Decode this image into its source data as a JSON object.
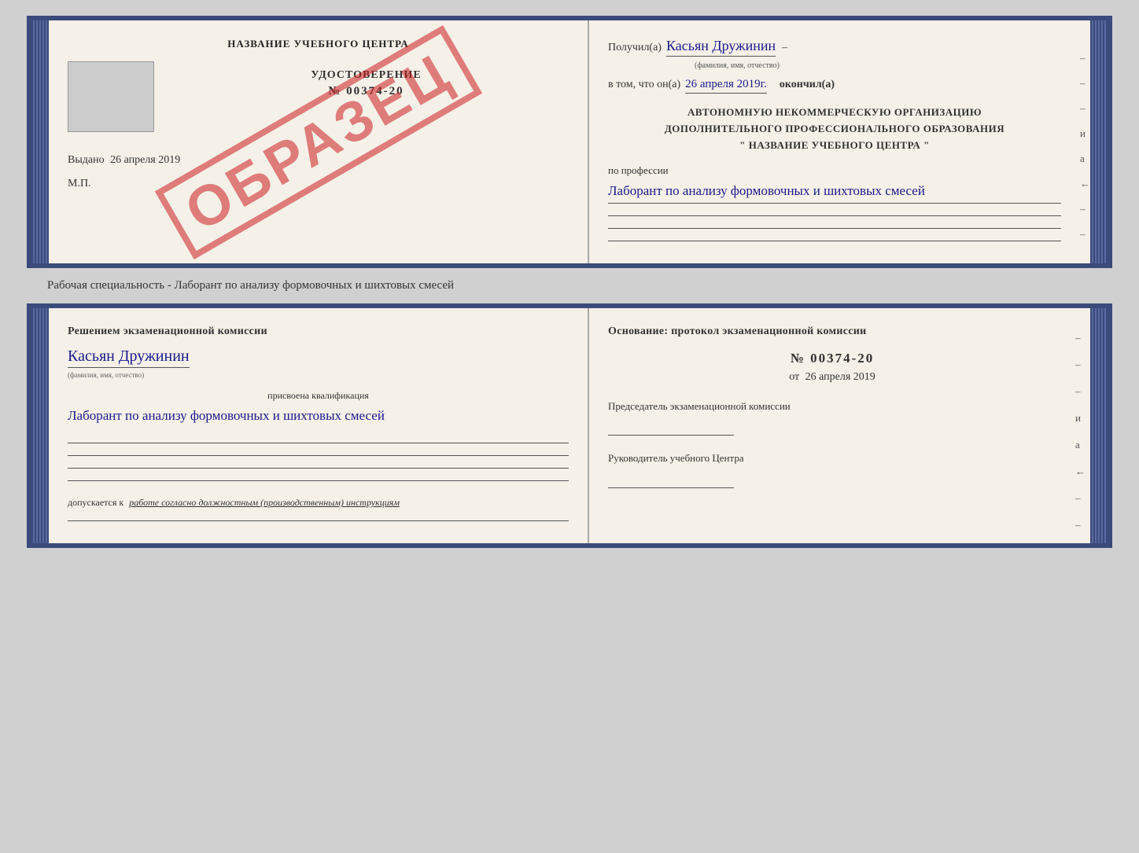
{
  "top_card": {
    "left": {
      "title": "НАЗВАНИЕ УЧЕБНОГО ЦЕНТРА",
      "cert_label": "УДОСТОВЕРЕНИЕ",
      "cert_number": "№ 00374-20",
      "issued_text": "Выдано",
      "issued_date": "26 апреля 2019",
      "mp_label": "М.П.",
      "stamp_text": "ОБРАЗЕЦ"
    },
    "right": {
      "received_label": "Получил(а)",
      "received_name": "Касьян Дружинин",
      "name_sub": "(фамилия, имя, отчество)",
      "in_that_label": "в том, что он(а)",
      "date_value": "26 апреля 2019г.",
      "finished_label": "окончил(а)",
      "org_line1": "АВТОНОМНУЮ НЕКОММЕРЧЕСКУЮ ОРГАНИЗАЦИЮ",
      "org_line2": "ДОПОЛНИТЕЛЬНОГО ПРОФЕССИОНАЛЬНОГО ОБРАЗОВАНИЯ",
      "org_line3": "\" НАЗВАНИЕ УЧЕБНОГО ЦЕНТРА \"",
      "profession_label": "по профессии",
      "profession_value": "Лаборант по анализу формовочных и шихтовых смесей",
      "dashes": [
        "–",
        "–",
        "–",
        "и",
        "а",
        "←",
        "–",
        "–"
      ]
    }
  },
  "specialty_label": "Рабочая специальность - Лаборант по анализу формовочных и шихтовых смесей",
  "bottom_card": {
    "left": {
      "section_title": "Решением экзаменационной комиссии",
      "name_value": "Касьян Дружинин",
      "name_sub": "(фамилия, имя, отчество)",
      "qual_label": "присвоена квалификация",
      "qual_value": "Лаборант по анализу формовочных и шихтовых смесей",
      "dopusk_label": "допускается к",
      "dopusk_value": "работе согласно должностным (производственным) инструкциям"
    },
    "right": {
      "osnov_title": "Основание: протокол экзаменационной комиссии",
      "protocol_number": "№ 00374-20",
      "protocol_date_prefix": "от",
      "protocol_date": "26 апреля 2019",
      "chairman_title": "Председатель экзаменационной комиссии",
      "director_title": "Руководитель учебного Центра",
      "dashes": [
        "–",
        "–",
        "–",
        "и",
        "а",
        "←",
        "–",
        "–"
      ]
    }
  }
}
